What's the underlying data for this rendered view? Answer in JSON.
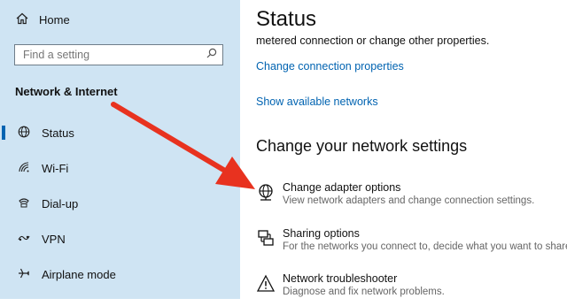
{
  "sidebar": {
    "home": {
      "label": "Home",
      "icon": "home-icon"
    },
    "search": {
      "placeholder": "Find a setting",
      "icon": "search-icon"
    },
    "section_title": "Network & Internet",
    "items": [
      {
        "label": "Status",
        "icon": "globe-icon",
        "active": true
      },
      {
        "label": "Wi-Fi",
        "icon": "wifi-icon",
        "active": false
      },
      {
        "label": "Dial-up",
        "icon": "phone-icon",
        "active": false
      },
      {
        "label": "VPN",
        "icon": "vpn-icon",
        "active": false
      },
      {
        "label": "Airplane mode",
        "icon": "airplane-icon",
        "active": false
      }
    ]
  },
  "main": {
    "title": "Status",
    "partial_text": "metered connection or change other properties.",
    "links": {
      "change_connection": "Change connection properties",
      "show_networks": "Show available networks"
    },
    "section_heading": "Change your network settings",
    "options": [
      {
        "title": "Change adapter options",
        "desc": "View network adapters and change connection settings.",
        "icon": "adapter-icon"
      },
      {
        "title": "Sharing options",
        "desc": "For the networks you connect to, decide what you want to share.",
        "icon": "sharing-icon"
      },
      {
        "title": "Network troubleshooter",
        "desc": "Diagnose and fix network problems.",
        "icon": "warning-icon"
      }
    ]
  },
  "colors": {
    "sidebar_bg": "#cfe4f3",
    "accent": "#0063b1",
    "arrow": "#e8321f"
  }
}
